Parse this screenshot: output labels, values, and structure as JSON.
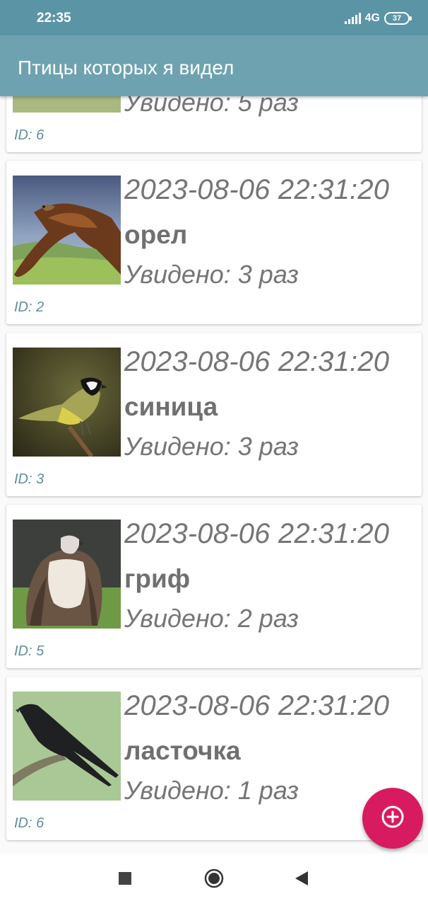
{
  "status_bar": {
    "time": "22:35",
    "network": "4G",
    "battery": "37"
  },
  "app_bar": {
    "title": "Птицы которых я видел"
  },
  "list": {
    "partial_item": {
      "count": "Увидено: 5 раз",
      "id": "ID: 6"
    },
    "items": [
      {
        "date": "2023-08-06 22:31:20",
        "name": "орел",
        "count": "Увидено: 3 раз",
        "id": "ID: 2",
        "image": "eagle-photo"
      },
      {
        "date": "2023-08-06 22:31:20",
        "name": "синица",
        "count": "Увидено: 3 раз",
        "id": "ID: 3",
        "image": "titmouse-photo"
      },
      {
        "date": "2023-08-06 22:31:20",
        "name": "гриф",
        "count": "Увидено: 2 раз",
        "id": "ID: 5",
        "image": "vulture-photo"
      },
      {
        "date": "2023-08-06 22:31:20",
        "name": "ласточка",
        "count": "Увидено: 1 раз",
        "id": "ID: 6",
        "image": "swallow-photo"
      }
    ]
  },
  "fab": {
    "icon": "add-circle-icon",
    "color": "#d81b60"
  },
  "nav_bar": {
    "recents_icon": "square-icon",
    "home_icon": "circle-icon",
    "back_icon": "triangle-back-icon"
  }
}
